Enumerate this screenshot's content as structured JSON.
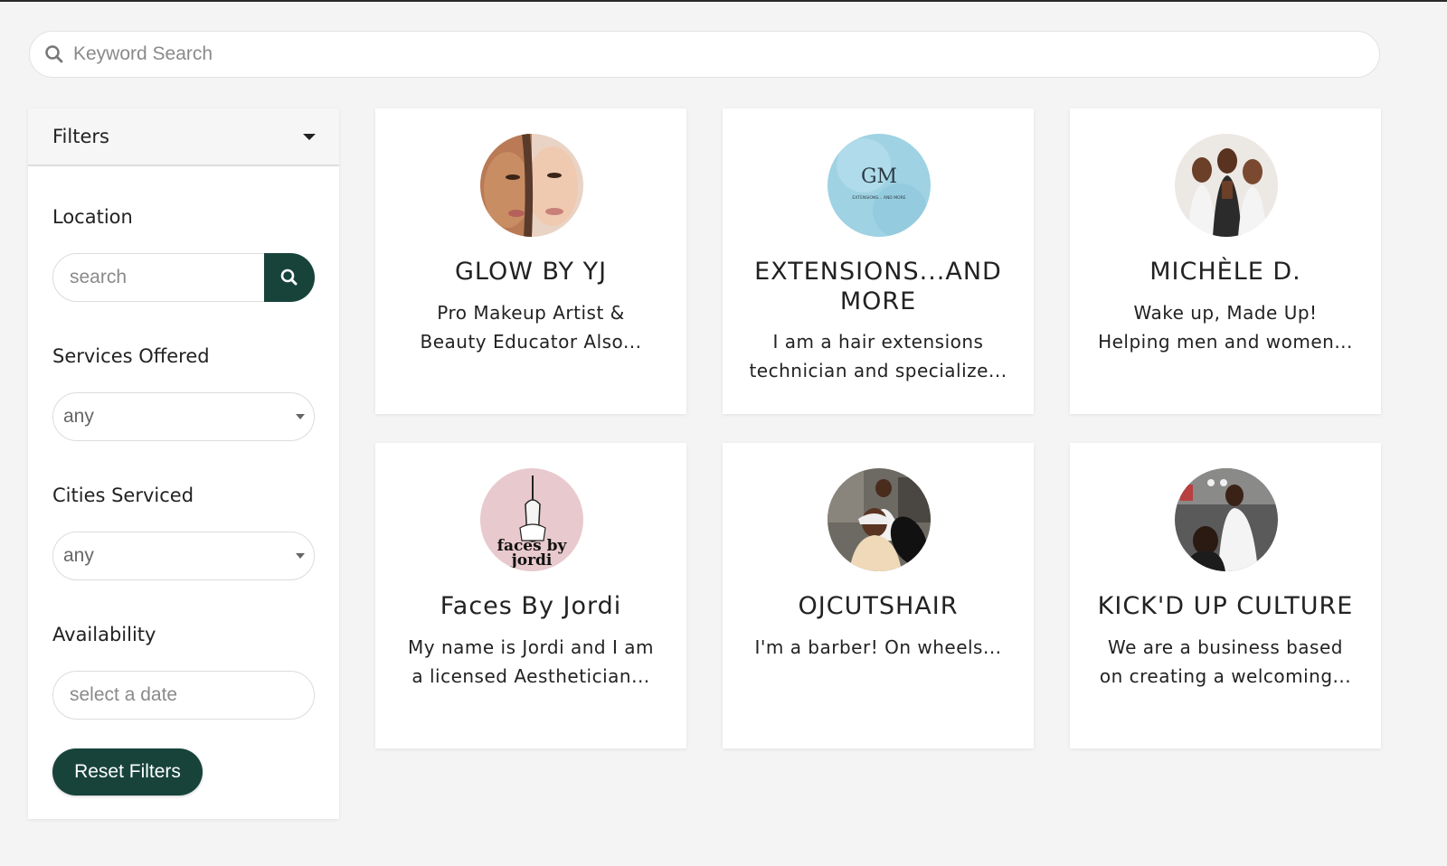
{
  "search": {
    "placeholder": "Keyword Search"
  },
  "filters": {
    "header": "Filters",
    "location": {
      "label": "Location",
      "placeholder": "search"
    },
    "services": {
      "label": "Services Offered",
      "value": "any"
    },
    "cities": {
      "label": "Cities Serviced",
      "value": "any"
    },
    "availability": {
      "label": "Availability",
      "placeholder": "select a date"
    },
    "reset_label": "Reset Filters"
  },
  "accent": "#17433b",
  "profiles": [
    {
      "name": "GLOW BY YJ",
      "desc1": "Pro Makeup Artist &",
      "desc2": "Beauty Educator Also..."
    },
    {
      "name1": "EXTENSIONS...AND",
      "name2": "MORE",
      "desc1": "I am a hair extensions",
      "desc2": "technician and specialize...",
      "logo_text": "GM",
      "logo_sub": "EXTENSIONS... AND MORE"
    },
    {
      "name": "MICHÈLE D.",
      "desc1": "Wake up, Made Up!",
      "desc2": "Helping men and women..."
    },
    {
      "name": "Faces By Jordi",
      "desc1": "My name is Jordi and I am",
      "desc2": "a licensed Aesthetician...",
      "logo_text1": "faces by",
      "logo_text2": "jordi"
    },
    {
      "name": "OJCUTSHAIR",
      "desc1": "I'm a barber! On wheels..."
    },
    {
      "name": "KICK'D UP CULTURE",
      "desc1": "We are a business based",
      "desc2": "on creating a welcoming..."
    }
  ]
}
